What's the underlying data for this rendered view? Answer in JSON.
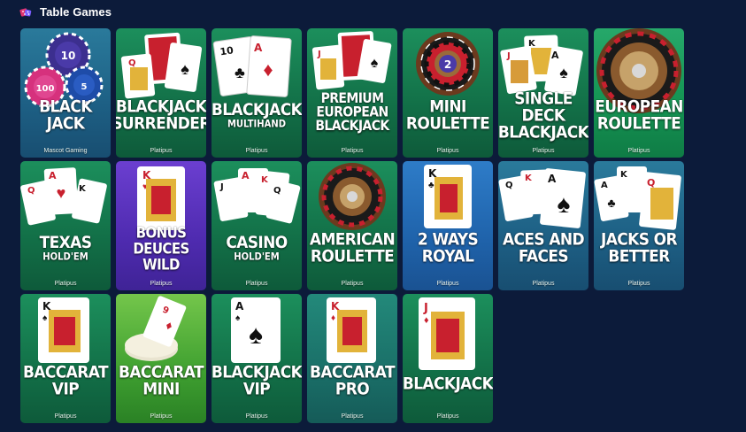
{
  "section": {
    "title": "Table Games",
    "icon": "dice-icon"
  },
  "colors": {
    "page_background": "#0c1b3a",
    "tile_green": "#137249",
    "tile_teal": "#1d5f84",
    "tile_purple": "#4f2bb0",
    "tile_blue": "#1f63ab",
    "tile_lime": "#3fa030"
  },
  "games": [
    {
      "name": "BLACK JACK",
      "sub": "",
      "provider": "Mascot Gaming"
    },
    {
      "name": "BLACKJACK SURRENDER",
      "sub": "",
      "provider": "Platipus"
    },
    {
      "name": "BLACKJACK",
      "sub": "MULTIHAND",
      "provider": "Platipus"
    },
    {
      "name": "PREMIUM EUROPEAN BLACKJACK",
      "sub": "",
      "provider": "Platipus"
    },
    {
      "name": "MINI ROULETTE",
      "sub": "",
      "provider": "Platipus"
    },
    {
      "name": "SINGLE DECK BLACKJACK",
      "sub": "",
      "provider": "Platipus"
    },
    {
      "name": "EUROPEAN ROULETTE",
      "sub": "",
      "provider": "Platipus"
    },
    {
      "name": "TEXAS",
      "sub": "HOLD'EM",
      "provider": "Platipus"
    },
    {
      "name": "BONUS DEUCES WILD",
      "sub": "",
      "provider": "Platipus"
    },
    {
      "name": "CASINO",
      "sub": "HOLD'EM",
      "provider": "Platipus"
    },
    {
      "name": "AMERICAN ROULETTE",
      "sub": "",
      "provider": "Platipus"
    },
    {
      "name": "2 WAYS ROYAL",
      "sub": "",
      "provider": "Platipus"
    },
    {
      "name": "ACES AND FACES",
      "sub": "",
      "provider": "Platipus"
    },
    {
      "name": "JACKS OR BETTER",
      "sub": "",
      "provider": "Platipus"
    },
    {
      "name": "BACCARAT VIP",
      "sub": "",
      "provider": "Platipus"
    },
    {
      "name": "BACCARAT MINI",
      "sub": "",
      "provider": "Platipus"
    },
    {
      "name": "BLACKJACK VIP",
      "sub": "",
      "provider": "Platipus"
    },
    {
      "name": "BACCARAT PRO",
      "sub": "",
      "provider": "Platipus"
    },
    {
      "name": "BLACKJACK",
      "sub": "",
      "provider": "Platipus"
    }
  ]
}
